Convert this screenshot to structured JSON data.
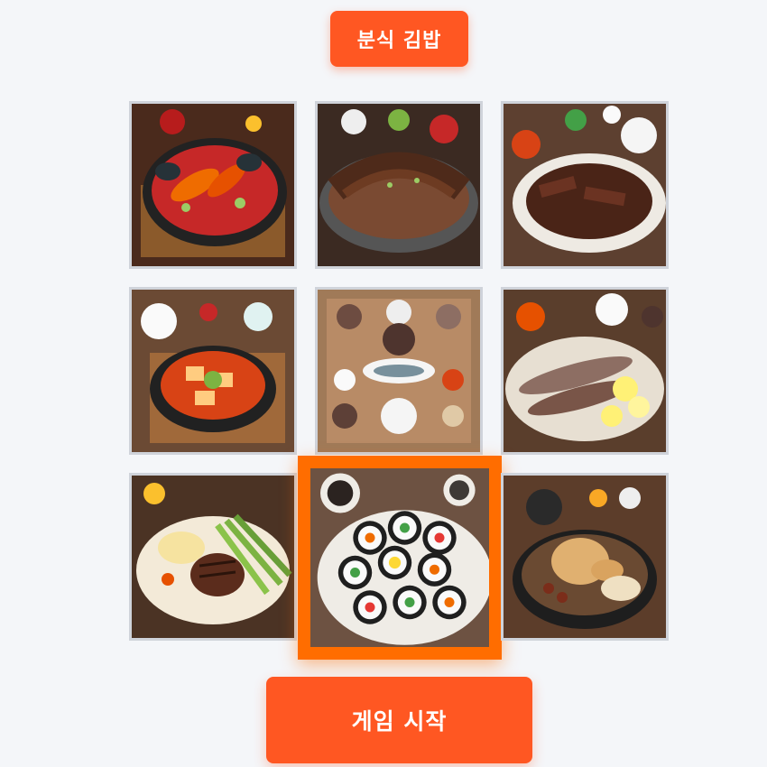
{
  "header": {
    "category_label": "분식 김밥"
  },
  "game": {
    "tiles": [
      {
        "icon": "spicy-seafood-stew-photo",
        "selected": false
      },
      {
        "icon": "grilled-eel-photo",
        "selected": false
      },
      {
        "icon": "bulgogi-photo",
        "selected": false
      },
      {
        "icon": "tofu-stew-photo",
        "selected": false
      },
      {
        "icon": "korean-table-spread-photo",
        "selected": false
      },
      {
        "icon": "grilled-mackerel-photo",
        "selected": false
      },
      {
        "icon": "steak-asparagus-photo",
        "selected": false
      },
      {
        "icon": "gimbap-photo",
        "selected": true
      },
      {
        "icon": "braised-chicken-photo",
        "selected": false
      }
    ]
  },
  "footer": {
    "start_label": "게임 시작"
  },
  "colors": {
    "accent": "#ff5722",
    "selected_border": "#ff6d00",
    "background": "#f4f6f9"
  }
}
